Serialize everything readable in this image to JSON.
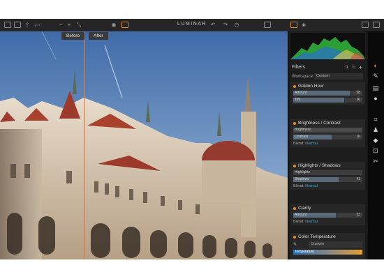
{
  "app": {
    "title": "LUMINAR"
  },
  "compare": {
    "before_label": "Before",
    "after_label": "After"
  },
  "panel": {
    "filters_title": "Filters",
    "workspace_label": "Workspace:",
    "workspace_value": "Custom"
  },
  "filters": [
    {
      "name": "Golden Hour",
      "sliders": [
        {
          "label": "Amount",
          "value": "58",
          "fraction": 0.82
        },
        {
          "label": "Tint",
          "value": "26",
          "fraction": 0.74
        }
      ],
      "blend": null
    },
    {
      "name": "Brightness / Contrast",
      "sliders": [
        {
          "label": "Brightness",
          "value": "",
          "fraction": 1.0
        },
        {
          "label": "Contrast",
          "value": "16",
          "fraction": 0.56
        }
      ],
      "blend": {
        "label": "Blend:",
        "value": "Normal"
      }
    },
    {
      "name": "Highlights / Shadows",
      "sliders": [
        {
          "label": "Highlights",
          "value": "",
          "fraction": 0.0
        },
        {
          "label": "Shadows",
          "value": "41",
          "fraction": 0.66
        }
      ],
      "blend": {
        "label": "Blend:",
        "value": "Normal"
      }
    },
    {
      "name": "Clarity",
      "sliders": [
        {
          "label": "Amount",
          "value": "33",
          "fraction": 0.62
        }
      ],
      "blend": {
        "label": "Blend:",
        "value": "Normal"
      }
    },
    {
      "name": "Color Temperature",
      "dropdown": "Custom",
      "sliders": [
        {
          "label": "Temperature",
          "value": "",
          "fraction": 0.0
        }
      ],
      "blend": null
    }
  ],
  "colors": {
    "accent": "#e88a2a",
    "blend_value": "#4aa0c8",
    "panel_bg": "#1d1d1d",
    "toolbar_bg": "#252525"
  },
  "icons": {
    "toolbar_left": [
      "folder-icon",
      "save-icon",
      "share-icon",
      "undo-icon",
      "zoom-out-icon",
      "zoom-in-icon",
      "fit-icon"
    ],
    "toolbar_center": [
      "eye-icon",
      "compare-icon"
    ],
    "toolbar_right": [
      "undo-history-icon",
      "redo-icon",
      "history-icon",
      "presets-icon",
      "layers-icon",
      "panel-toggle-icon",
      "fullscreen-icon"
    ],
    "tools": [
      "filters-icon",
      "brush-icon",
      "layers-stack-icon",
      "mask-icon",
      "crop-icon",
      "clone-stamp-icon",
      "eraser-icon",
      "transform-icon",
      "scissors-icon"
    ]
  }
}
